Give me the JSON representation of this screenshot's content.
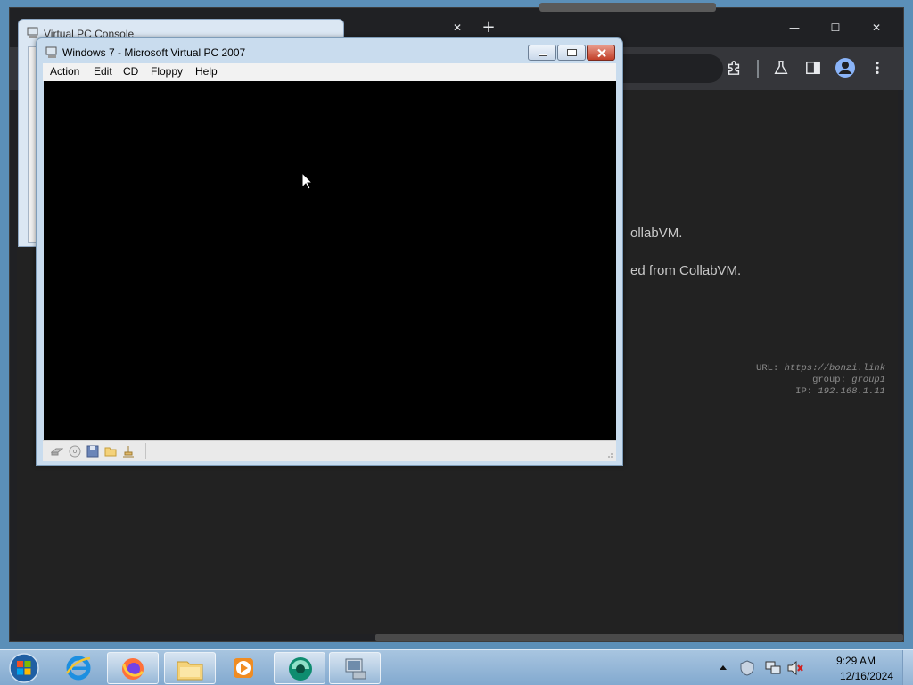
{
  "chrome": {
    "content_lines": [
      "ollabVM.",
      "ed from CollabVM."
    ],
    "info": [
      {
        "label": "URL:",
        "value": "https://bonzi.link"
      },
      {
        "label": "group:",
        "value": "group1"
      },
      {
        "label": "IP:",
        "value": "192.168.1.11"
      }
    ],
    "tab_close_glyph": "✕",
    "new_tab_glyph": "+",
    "win_min_glyph": "—",
    "win_max_glyph": "☐",
    "win_close_glyph": "✕"
  },
  "console": {
    "title": "Virtual PC Console"
  },
  "vpc": {
    "title": "Windows 7 - Microsoft Virtual PC 2007",
    "menu": [
      "Action",
      "Edit",
      "CD",
      "Floppy",
      "Help"
    ]
  },
  "taskbar": {
    "apps": [
      {
        "name": "internet-explorer-icon",
        "open": false
      },
      {
        "name": "firefox-icon",
        "open": true
      },
      {
        "name": "file-explorer-icon",
        "open": true
      },
      {
        "name": "media-player-icon",
        "open": false
      },
      {
        "name": "virtual-pc-console-icon",
        "open": true
      },
      {
        "name": "virtual-pc-window-icon",
        "open": true
      }
    ],
    "time": "9:29 AM",
    "date": "12/16/2024"
  }
}
